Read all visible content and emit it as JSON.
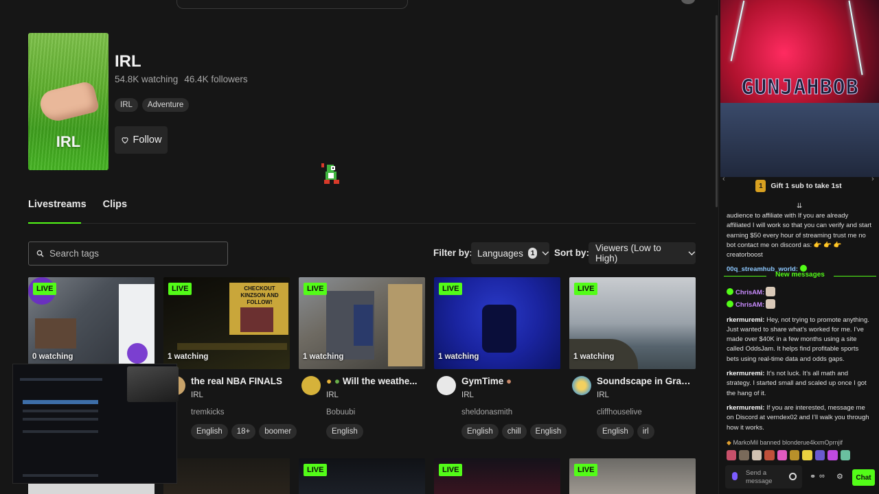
{
  "category": {
    "cover_text": "IRL",
    "title": "IRL",
    "watching": "54.8K watching",
    "followers": "46.4K followers",
    "tags": [
      "IRL",
      "Adventure"
    ],
    "follow_label": "Follow"
  },
  "tabs": [
    {
      "label": "Livestreams",
      "active": true
    },
    {
      "label": "Clips",
      "active": false
    }
  ],
  "search": {
    "placeholder": "Search tags"
  },
  "filters": {
    "filter_label": "Filter by:",
    "languages_label": "Languages",
    "languages_count": "1",
    "sort_label": "Sort by:",
    "sort_value": "Viewers (Low to High)"
  },
  "streams": [
    {
      "badge": "LIVE",
      "viewers": "0 watching",
      "title": "",
      "category": "",
      "user": "",
      "tags": []
    },
    {
      "badge": "LIVE",
      "viewers": "1 watching",
      "title": "the real NBA FINALS",
      "category": "IRL",
      "user": "tremkicks",
      "tags": [
        "English",
        "18+",
        "boomer"
      ]
    },
    {
      "badge": "LIVE",
      "viewers": "1 watching",
      "title": "Will the weathe...",
      "category": "IRL",
      "user": "Bobuubi",
      "tags": [
        "English"
      ]
    },
    {
      "badge": "LIVE",
      "viewers": "1 watching",
      "title": "GymTime",
      "category": "IRL",
      "user": "sheldonasmith",
      "tags": [
        "English",
        "chill",
        "English"
      ]
    },
    {
      "badge": "LIVE",
      "viewers": "1 watching",
      "title": "Soundscape in Gran C...",
      "category": "IRL",
      "user": "cliffhouselive",
      "tags": [
        "English",
        "irl"
      ]
    }
  ],
  "row2_badges": [
    "LIVE",
    "LIVE",
    "LIVE"
  ],
  "thumb_texts": {
    "card1": "CHECKOUT KINZSON AND FOLLOW!"
  },
  "sidebar": {
    "banner_title": "GUNJAHBOB",
    "gift_count": "1",
    "gift_text": "Gift 1 sub to take 1st",
    "chat": {
      "pinned_text": "audience to affiliate with If you are already affiliated I will work so that you can verify and start earning $50 every hour of streaming trust me no bot contact me on discord as: 👉 👉 👉creatorboost",
      "msg1_user": "00q_streamhub_world:",
      "new_messages": "New messages",
      "msg2_user": "ChrisAM:",
      "msg3_user": "ChrisAM:",
      "msg4_user": "rkermuremi:",
      "msg4_text": "Hey, not trying to promote anything. Just wanted to share what’s worked for me. I’ve made over $40K in a few months using a site called OddsJam. It helps find profitable sports bets using real-time data and odds gaps.",
      "msg5_user": "rkermuremi:",
      "msg5_text": "It’s not luck. It’s all math and strategy. I started small and scaled up once I got the hang of it.",
      "msg6_user": "rkermuremi:",
      "msg6_text": "If you are interested, message me on Discord at verndex02 and I’ll walk you through how it works.",
      "ban_text": "MarkoMil banned blonderue4kxmOprnjif"
    },
    "input_placeholder": "Send a message",
    "chat_button": "Chat"
  },
  "colors": {
    "accent": "#53fc18",
    "background": "#161616",
    "panel": "#262626"
  }
}
